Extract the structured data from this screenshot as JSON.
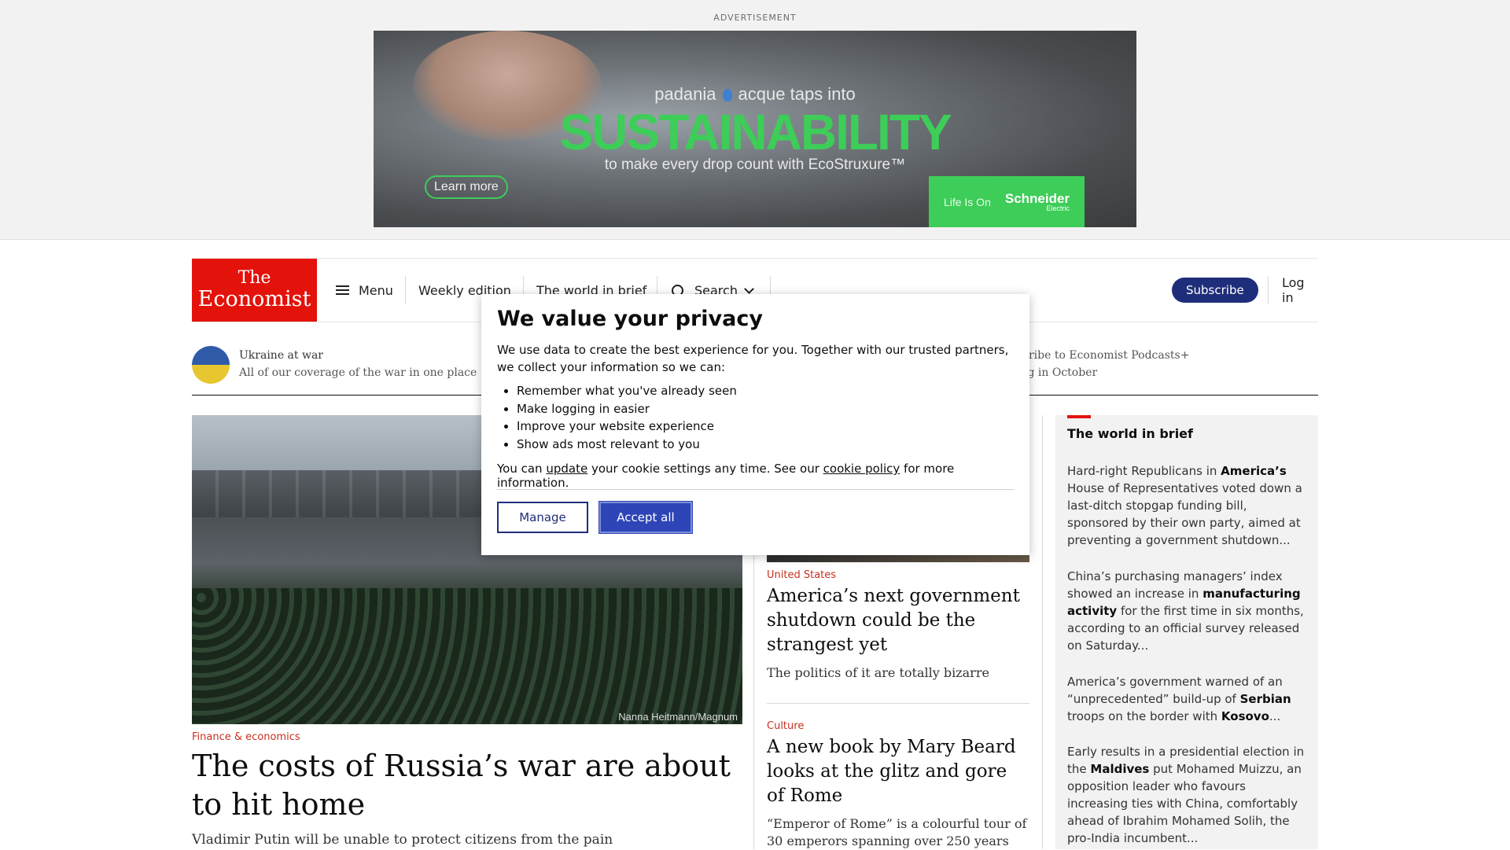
{
  "ad": {
    "label": "ADVERTISEMENT",
    "brand_left": "padania",
    "brand_right": "acque",
    "brand_tail": "taps into",
    "headline": "SUSTAINABILITY",
    "subline": "to make every drop count with EcoStruxure™",
    "cta": "Learn more",
    "logo_tag": "Life Is On",
    "logo_brand": "Schneider",
    "logo_brand_sub": "Electric"
  },
  "header": {
    "logo_line1": "The",
    "logo_line2": "Economist",
    "menu": "Menu",
    "weekly_edition": "Weekly edition",
    "world_in_brief": "The world in brief",
    "search": "Search",
    "subscribe": "Subscribe",
    "login": "Log in"
  },
  "strip": {
    "title": "Ukraine at war",
    "subtitle": "All of our coverage of the war in one place",
    "right_title": "bscribe to Economist Podcasts+",
    "right_subtitle": "ning in October"
  },
  "lead": {
    "image_credit": "Nanna Heitmann/Magnum",
    "section": "Finance & economics",
    "headline": "The costs of Russia’s war are about to hit home",
    "rubric": "Vladimir Putin will be unable to protect citizens from the pain"
  },
  "middle": {
    "story1": {
      "section": "United States",
      "headline": "America’s next government shutdown could be the strangest yet",
      "rubric": "The politics of it are totally bizarre"
    },
    "story2": {
      "section": "Culture",
      "headline": "A new book by Mary Beard looks at the glitz and gore of Rome",
      "rubric": "“Emperor of Rome” is a colourful tour of 30 emperors spanning over 250 years"
    }
  },
  "brief": {
    "title": "The world in brief",
    "items": [
      {
        "pre": "Hard-right Republicans in ",
        "bold": "America’s",
        "post": " House of Representatives voted down a last-ditch stopgap funding bill, sponsored by their own party, aimed at preventing a government shutdown..."
      },
      {
        "pre": "China’s purchasing managers’ index showed an increase in ",
        "bold": "manufacturing activity",
        "post": " for the first time in six months, according to an official survey released on Saturday..."
      },
      {
        "pre": "America’s government warned of an “unprecedented” build-up of ",
        "bold": "Serbian",
        "mid": " troops on the border with ",
        "bold2": "Kosovo",
        "post": "..."
      },
      {
        "pre": "Early results in a presidential election in the ",
        "bold": "Maldives",
        "post": " put Mohamed Muizzu, an opposition leader who favours increasing ties with China, comfortably ahead of Ibrahim Mohamed Solih, the pro-India incumbent..."
      }
    ]
  },
  "privacy": {
    "title": "We value your privacy",
    "intro": "We use data to create the best experience for you. Together with our trusted partners, we collect your information so we can:",
    "bullets": [
      "Remember what you've already seen",
      "Make logging in easier",
      "Improve your website experience",
      "Show ads most relevant to you"
    ],
    "note_pre": "You can ",
    "note_link1": "update",
    "note_mid": " your cookie settings any time. See our ",
    "note_link2": "cookie policy",
    "note_post": " for more information.",
    "manage": "Manage",
    "accept": "Accept all"
  },
  "colors": {
    "brand_red": "#e3120b",
    "subscribe_navy": "#1f2e7a",
    "accept_blue": "#2e45b8",
    "section_red": "#c5311f",
    "ad_green": "#3dcd58"
  }
}
